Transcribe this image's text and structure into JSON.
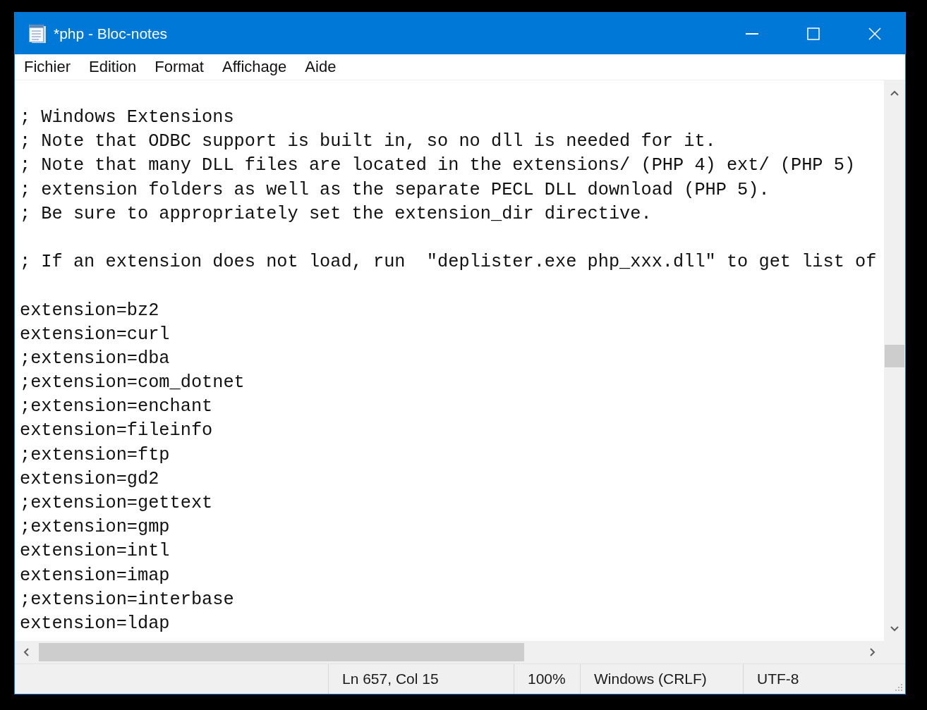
{
  "window": {
    "title": "*php - Bloc-notes"
  },
  "menu": [
    "Fichier",
    "Edition",
    "Format",
    "Affichage",
    "Aide"
  ],
  "editor": {
    "blocks": [
      {
        "lines": [
          "; Windows Extensions",
          "; Note that ODBC support is built in, so no dll is needed for it.",
          "; Note that many DLL files are located in the extensions/ (PHP 4) ext/ (PHP 5)",
          "; extension folders as well as the separate PECL DLL download (PHP 5).",
          "; Be sure to appropriately set the extension_dir directive."
        ]
      },
      {
        "lines": [
          "; If an extension does not load, run  \"deplister.exe php_xxx.dll\" to get list of"
        ]
      },
      {
        "lines": [
          "extension=bz2",
          "extension=curl",
          ";extension=dba",
          ";extension=com_dotnet",
          ";extension=enchant",
          "extension=fileinfo",
          ";extension=ftp",
          "extension=gd2",
          ";extension=gettext",
          ";extension=gmp",
          "extension=intl",
          "extension=imap",
          ";extension=interbase",
          "extension=ldap"
        ]
      }
    ]
  },
  "status_bar": [
    "Ln 657, Col 15",
    "100%",
    "Windows (CRLF)",
    "UTF-8"
  ]
}
